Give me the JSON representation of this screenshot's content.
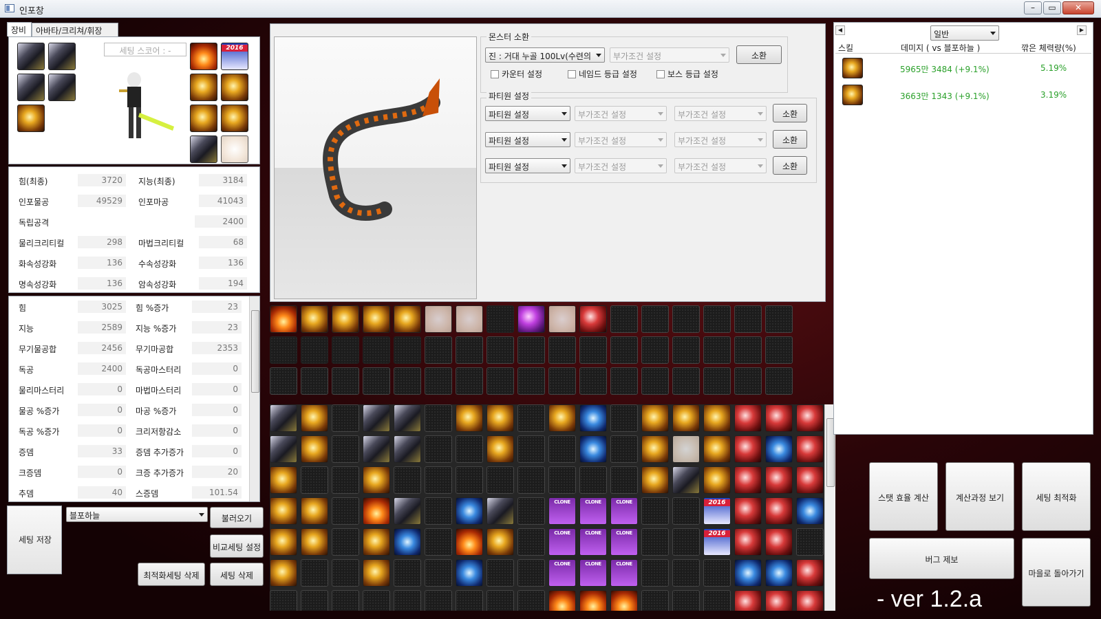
{
  "window": {
    "title": "인포창",
    "min": "–",
    "max": "▭",
    "close": "✕"
  },
  "tabs": [
    "장비",
    "아바타/크리쳐/휘장"
  ],
  "equipment": {
    "score_placeholder": "세팅 스코어 : -",
    "left_slots": [
      "armor",
      "armor",
      "armor",
      "armor",
      "boots"
    ],
    "right_slots": [
      "weapon",
      "2016",
      "bracelet",
      "accessory",
      "ring",
      "ring",
      "ring",
      "scroll"
    ]
  },
  "stats_top": [
    {
      "l1": "힘(최종)",
      "v1": "3720",
      "l2": "지능(최종)",
      "v2": "3184"
    },
    {
      "l1": "인포물공",
      "v1": "49529",
      "l2": "인포마공",
      "v2": "41043"
    },
    {
      "l1": "독립공격",
      "v1": "",
      "l2": "",
      "v2": "2400"
    },
    {
      "l1": "물리크리티컬",
      "v1": "298",
      "l2": "마법크리티컬",
      "v2": "68"
    },
    {
      "l1": "화속성강화",
      "v1": "136",
      "l2": "수속성강화",
      "v2": "136"
    },
    {
      "l1": "명속성강화",
      "v1": "136",
      "l2": "암속성강화",
      "v2": "194"
    }
  ],
  "stats_bottom": [
    {
      "l1": "힘",
      "v1": "3025",
      "l2": "힘 %증가",
      "v2": "23"
    },
    {
      "l1": "지능",
      "v1": "2589",
      "l2": "지능 %증가",
      "v2": "23"
    },
    {
      "l1": "무기물공합",
      "v1": "2456",
      "l2": "무기마공합",
      "v2": "2353"
    },
    {
      "l1": "독공",
      "v1": "2400",
      "l2": "독공마스터리",
      "v2": "0"
    },
    {
      "l1": "물리마스터리",
      "v1": "0",
      "l2": "마법마스터리",
      "v2": "0"
    },
    {
      "l1": "물공 %증가",
      "v1": "0",
      "l2": "마공 %증가",
      "v2": "0"
    },
    {
      "l1": "독공 %증가",
      "v1": "0",
      "l2": "크리저항감소",
      "v2": "0"
    },
    {
      "l1": "증뎀",
      "v1": "33",
      "l2": "증뎀 추가증가",
      "v2": "0"
    },
    {
      "l1": "크증뎀",
      "v1": "0",
      "l2": "크증 추가증가",
      "v2": "20"
    },
    {
      "l1": "추뎀",
      "v1": "40",
      "l2": "스증뎀",
      "v2": "101.54"
    }
  ],
  "bottom_left": {
    "save": "세팅 저장",
    "setting_combo": "블포하늘",
    "load": "불러오기",
    "compare": "비교세팅 설정",
    "delete_opt": "최적화세팅 삭제",
    "delete": "세팅 삭제"
  },
  "monster": {
    "group_label": "몬스터 소환",
    "select": "진 : 거대 누골 100Lv(수련의",
    "cond": "부가조건 설정",
    "summon": "소환",
    "checks": [
      "카운터 설정",
      "네임드 등급 설정",
      "보스 등급 설정"
    ]
  },
  "party": {
    "group_label": "파티원 설정",
    "rows": [
      {
        "member": "파티원 설정",
        "c1": "부가조건 설정",
        "c2": "부가조건 설정",
        "btn": "소환"
      },
      {
        "member": "파티원 설정",
        "c1": "부가조건 설정",
        "c2": "부가조건 설정",
        "btn": "소환"
      },
      {
        "member": "파티원 설정",
        "c1": "부가조건 설정",
        "c2": "부가조건 설정",
        "btn": "소환"
      }
    ]
  },
  "buff_row1": [
    "fire",
    "gold",
    "gold",
    "gold",
    "gold",
    "pale",
    "pale",
    "dark",
    "purple",
    "pale",
    "red"
  ],
  "inventory_grid_labels": {
    "clone": "CLONE",
    "year": "2016"
  },
  "results": {
    "mode": "일반",
    "headers": [
      "스킬",
      "데미지 ( vs 블포하늘 )",
      "깎은 체력량(%)"
    ],
    "rows": [
      {
        "damage": "5965만 3484 (+9.1%)",
        "pct": "5.19%"
      },
      {
        "damage": "3663만 1343 (+9.1%)",
        "pct": "3.19%"
      }
    ]
  },
  "actions": {
    "stat_eff": "스탯 효율 계산",
    "process": "계산과정 보기",
    "optimize": "세팅 최적화",
    "bug": "버그 제보",
    "town": "마을로 돌아가기"
  },
  "version": "- ver 1.2.a"
}
